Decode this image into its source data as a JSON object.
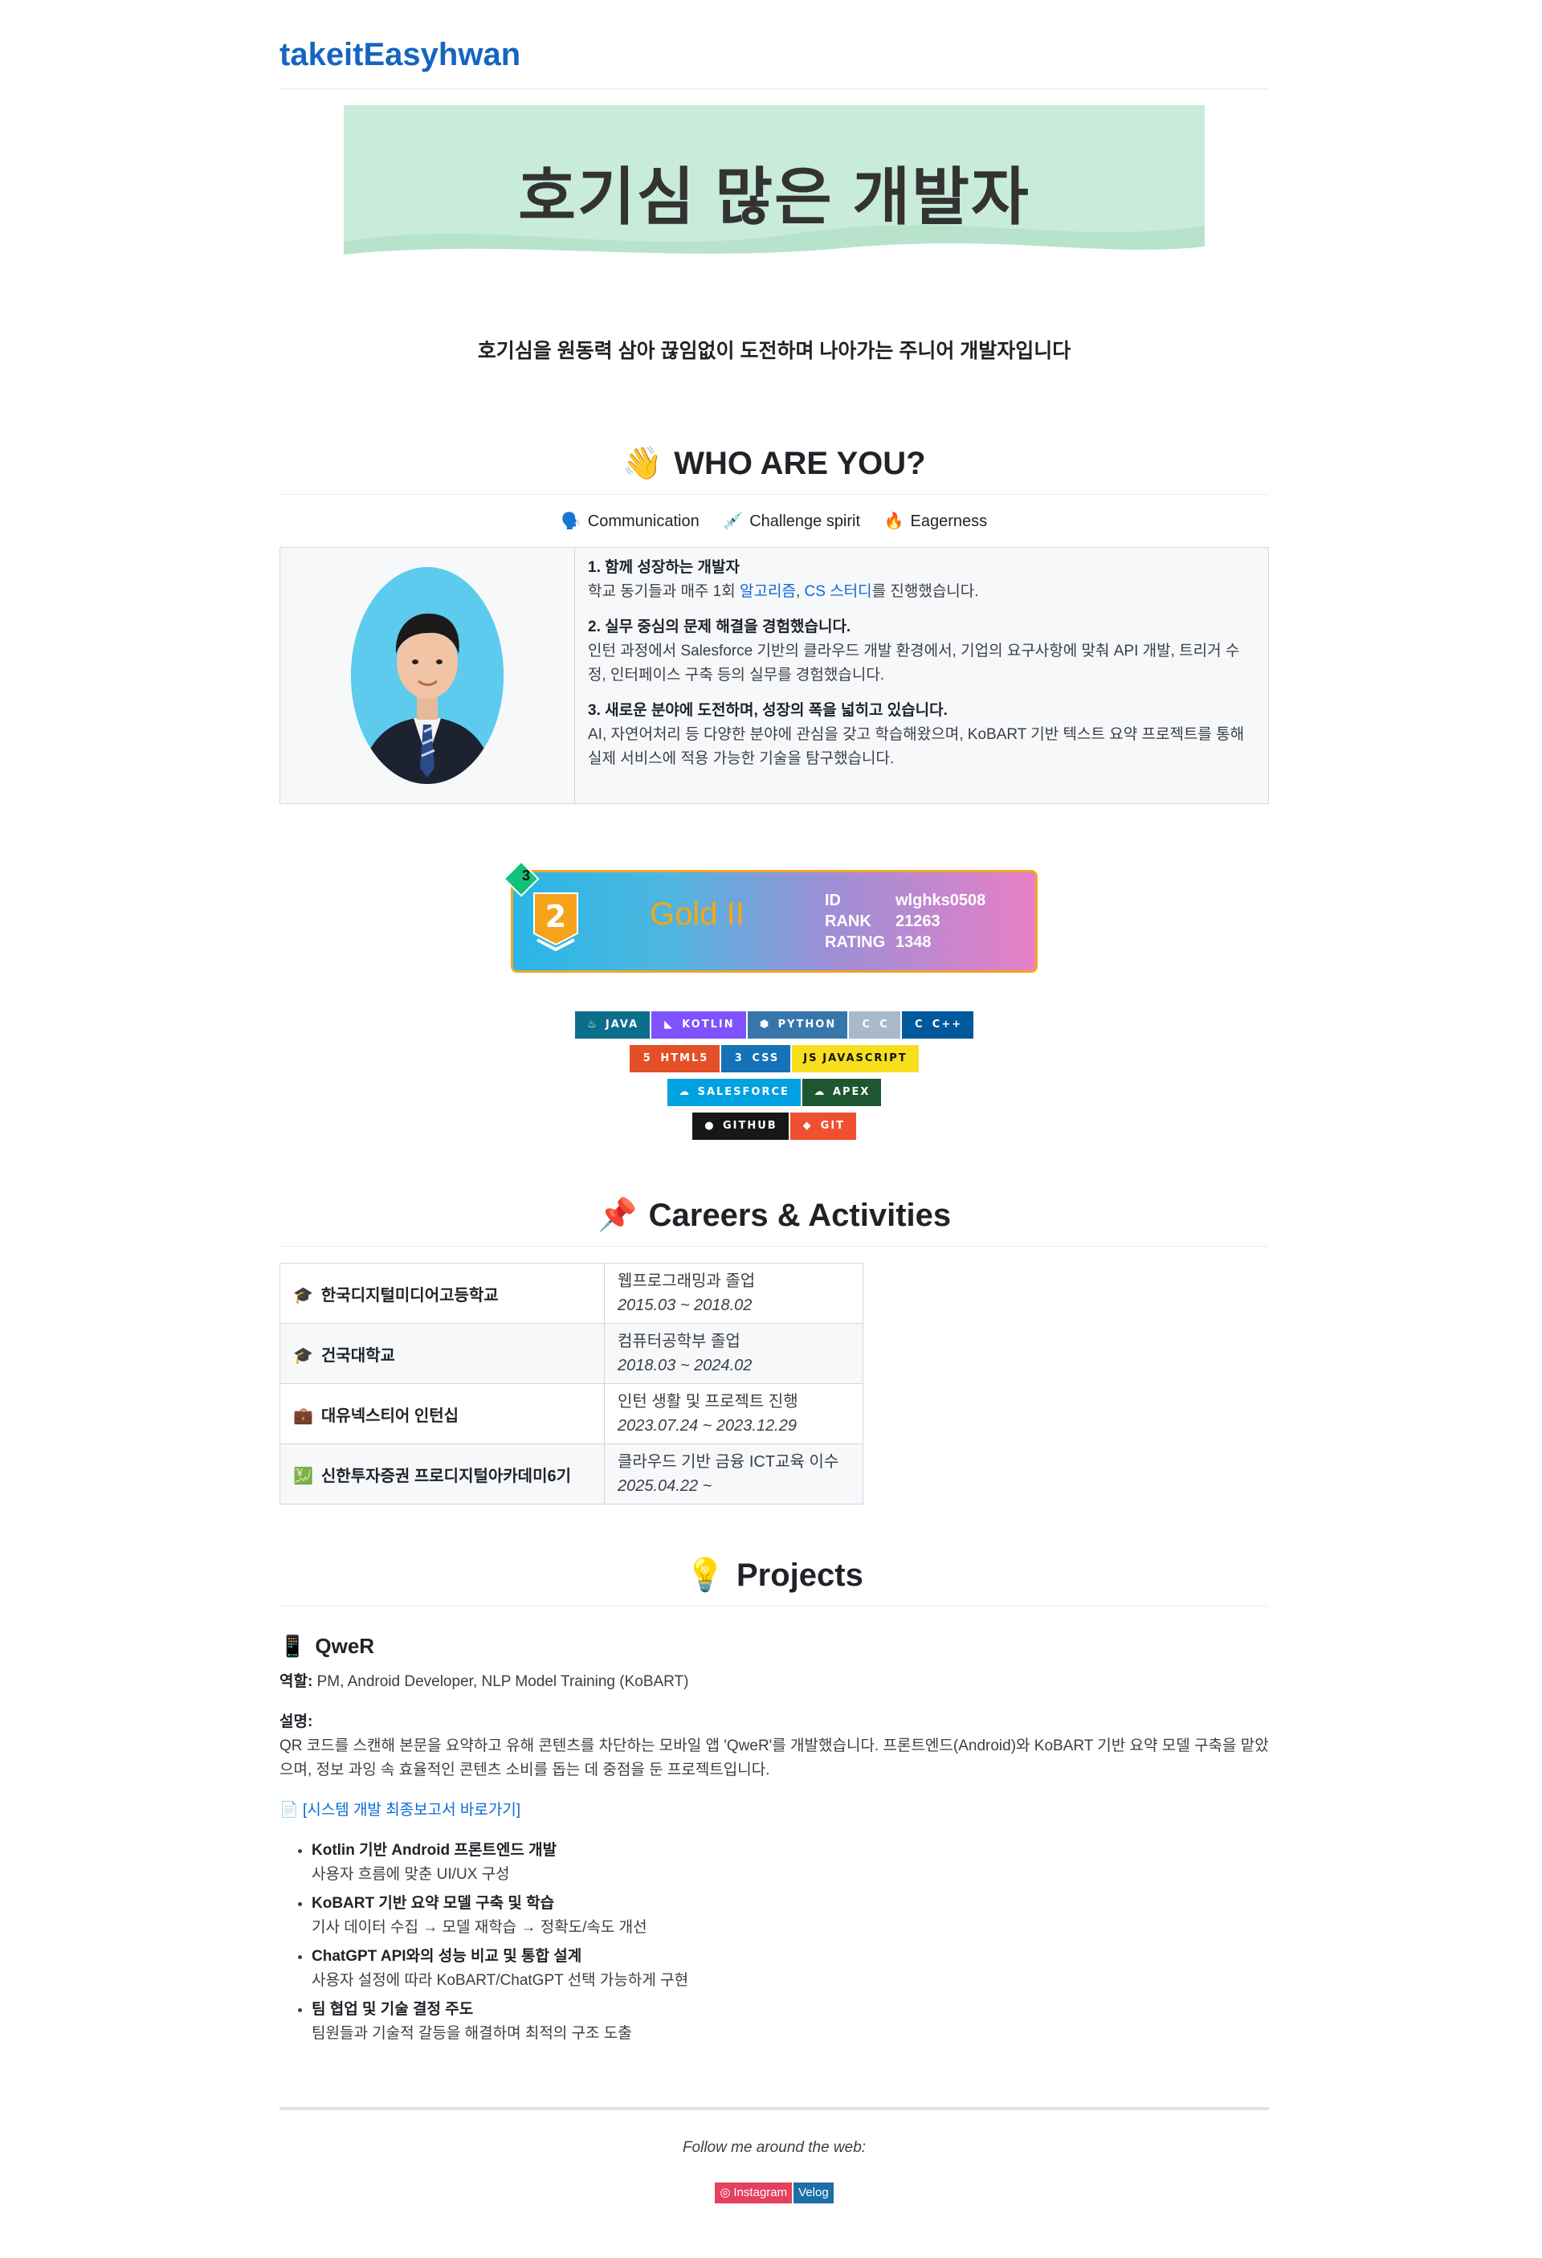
{
  "header": {
    "site_title": "takeitEasyhwan"
  },
  "banner": {
    "text": "호기심 많은 개발자"
  },
  "tagline": "호기심을 원동력 삼아 끊임없이 도전하며 나아가는 주니어 개발자입니다",
  "who": {
    "heading": "WHO ARE YOU?",
    "heading_emoji": "👋",
    "traits": [
      {
        "icon": "🗣️",
        "label": "Communication"
      },
      {
        "icon": "💉",
        "label": "Challenge spirit"
      },
      {
        "icon": "🔥",
        "label": "Eagerness"
      }
    ],
    "points": [
      {
        "title": "1. 함께 성장하는 개발자",
        "pre": "학교 동기들과 매주 1회 ",
        "link1": "알고리즘",
        "sep": ", ",
        "link2": "CS 스터디",
        "post": "를 진행했습니다."
      },
      {
        "title": "2. 실무 중심의 문제 해결을 경험했습니다.",
        "body": "인턴 과정에서 Salesforce 기반의 클라우드 개발 환경에서, 기업의 요구사항에 맞춰 API 개발, 트리거 수정, 인터페이스 구축 등의 실무를 경험했습니다."
      },
      {
        "title": "3. 새로운 분야에 도전하며, 성장의 폭을 넓히고 있습니다.",
        "body": "AI, 자연어처리 등 다양한 분야에 관심을 갖고 학습해왔으며, KoBART 기반 텍스트 요약 프로젝트를 통해 실제 서비스에 적용 가능한 기술을 탐구했습니다."
      }
    ]
  },
  "rank_card": {
    "class_num": "3",
    "tier_num": "2",
    "tier": "Gold II",
    "id_label": "ID",
    "id": "wlghks0508",
    "rank_label": "RANK",
    "rank": "21263",
    "rating_label": "RATING",
    "rating": "1348",
    "accent": "#f5a623"
  },
  "badges": [
    [
      {
        "label": "JAVA",
        "icon": "♨",
        "color": "#0d6e8c"
      },
      {
        "label": "KOTLIN",
        "icon": "◣",
        "color": "#7f52ff"
      },
      {
        "label": "PYTHON",
        "icon": "⬢",
        "color": "#3776ab"
      },
      {
        "label": "C",
        "icon": "C",
        "color": "#a8b9cc"
      },
      {
        "label": "C++",
        "icon": "C",
        "color": "#00599c"
      }
    ],
    [
      {
        "label": "HTML5",
        "icon": "5",
        "color": "#e34f26"
      },
      {
        "label": "CSS",
        "icon": "3",
        "color": "#1572b6"
      },
      {
        "label": "JAVASCRIPT",
        "icon": "JS",
        "color": "#f7df1e",
        "dark": true
      }
    ],
    [
      {
        "label": "SALESFORCE",
        "icon": "☁",
        "color": "#00a1e0"
      },
      {
        "label": "APEX",
        "icon": "☁",
        "color": "#1e5631"
      }
    ],
    [
      {
        "label": "GITHUB",
        "icon": "●",
        "color": "#181717"
      },
      {
        "label": "GIT",
        "icon": "◆",
        "color": "#f05032"
      }
    ]
  ],
  "careers": {
    "heading": "Careers & Activities",
    "heading_emoji": "📌",
    "rows": [
      {
        "icon": "🎓",
        "org": "한국디지털미디어고등학교",
        "desc": "웹프로그래밍과 졸업",
        "period": "2015.03 ~ 2018.02"
      },
      {
        "icon": "🎓",
        "org": "건국대학교",
        "desc": "컴퓨터공학부 졸업",
        "period": "2018.03 ~ 2024.02"
      },
      {
        "icon": "💼",
        "org": "대유넥스티어 인턴십",
        "desc": "인턴 생활 및 프로젝트 진행",
        "period": "2023.07.24 ~ 2023.12.29"
      },
      {
        "icon": "💹",
        "org": "신한투자증권 프로디지털아카데미6기",
        "desc": "클라우드 기반 금융 ICT교육 이수",
        "period": "2025.04.22 ~"
      }
    ]
  },
  "projects": {
    "heading": "Projects",
    "heading_emoji": "💡",
    "items": [
      {
        "icon": "📱",
        "title": "QweR",
        "role_label": "역할:",
        "role": "PM, Android Developer, NLP Model Training (KoBART)",
        "desc_label": "설명:",
        "desc": "QR 코드를 스캔해 본문을 요약하고 유해 콘텐츠를 차단하는 모바일 앱 'QweR'를 개발했습니다. 프론트엔드(Android)와 KoBART 기반 요약 모델 구축을 맡았으며, 정보 과잉 속 효율적인 콘텐츠 소비를 돕는 데 중점을 둔 프로젝트입니다.",
        "report_icon": "📄",
        "report_link": "[시스템 개발 최종보고서 바로가기]",
        "bullets": [
          {
            "title": "Kotlin 기반 Android 프론트엔드 개발",
            "detail": "사용자 흐름에 맞춘 UI/UX 구성"
          },
          {
            "title": "KoBART 기반 요약 모델 구축 및 학습",
            "detail": "기사 데이터 수집 → 모델 재학습 → 정확도/속도 개선"
          },
          {
            "title": "ChatGPT API와의 성능 비교 및 통합 설계",
            "detail": "사용자 설정에 따라 KoBART/ChatGPT 선택 가능하게 구현"
          },
          {
            "title": "팀 협업 및 기술 결정 주도",
            "detail": "팀원들과 기술적 갈등을 해결하며 최적의 구조 도출"
          }
        ]
      }
    ]
  },
  "footer": {
    "follow_text": "Follow me around the web:",
    "socials": [
      {
        "label": "Instagram",
        "icon": "◎",
        "color": "#e4405f"
      },
      {
        "label": "Velog",
        "icon": "",
        "color": "#1d6fa5"
      }
    ]
  }
}
